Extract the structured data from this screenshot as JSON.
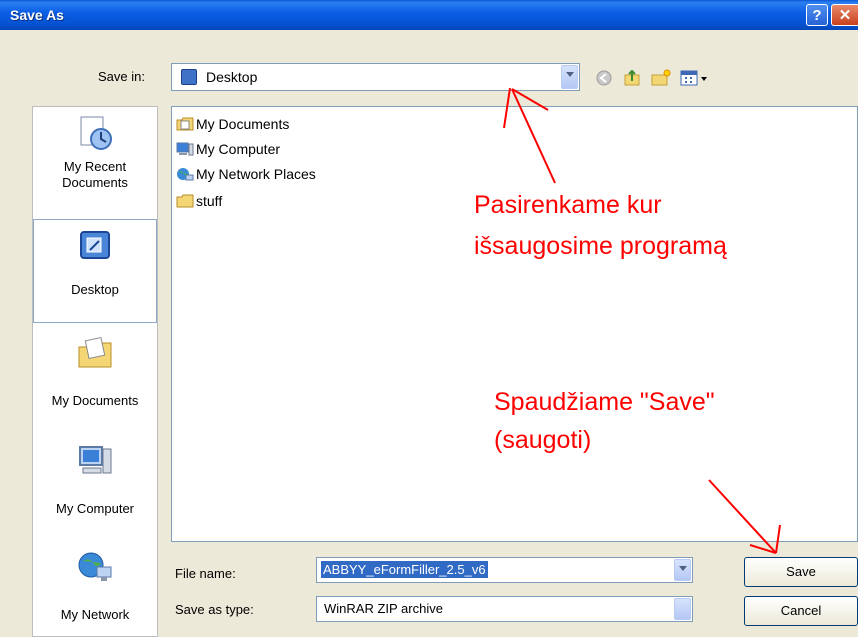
{
  "window": {
    "title": "Save As",
    "help_glyph": "?",
    "close_glyph": "✕"
  },
  "toolbar": {
    "save_in_label": "Save in:",
    "location": "Desktop"
  },
  "places": [
    {
      "label": "My Recent\nDocuments",
      "icon": "recent-documents-icon"
    },
    {
      "label": "Desktop",
      "icon": "desktop-icon"
    },
    {
      "label": "My Documents",
      "icon": "my-documents-icon"
    },
    {
      "label": "My Computer",
      "icon": "my-computer-icon"
    },
    {
      "label": "My Network",
      "icon": "my-network-icon"
    }
  ],
  "files": [
    {
      "name": "My Documents",
      "icon": "folder-documents-icon"
    },
    {
      "name": "My Computer",
      "icon": "computer-icon"
    },
    {
      "name": "My Network Places",
      "icon": "network-icon"
    },
    {
      "name": "stuff",
      "icon": "folder-icon"
    }
  ],
  "footer": {
    "file_name_label": "File name:",
    "file_name_value": "ABBYY_eFormFiller_2.5_v6",
    "save_type_label": "Save as type:",
    "save_type_value": "WinRAR ZIP archive",
    "save_button": "Save",
    "cancel_button": "Cancel"
  },
  "annotations": {
    "location_note_line1": "Pasirenkame kur",
    "location_note_line2": "išsaugosime programą",
    "save_note_line1": "Spaudžiame \"Save\"",
    "save_note_line2": "(saugoti)",
    "color": "#ff0000"
  },
  "colors": {
    "titlebar": "#0552d2",
    "dialog_bg": "#ece9d8",
    "selection": "#316ac5"
  }
}
